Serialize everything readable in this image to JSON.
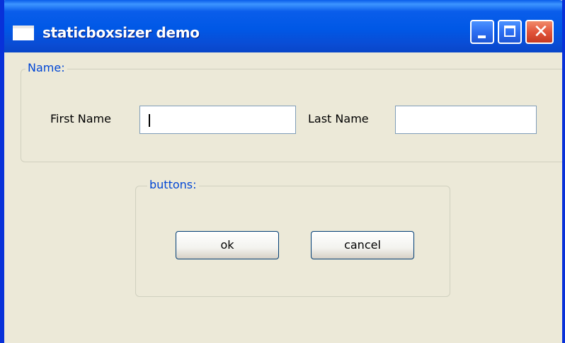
{
  "window": {
    "title": "staticboxsizer demo",
    "controls": {
      "minimize_icon": "minimize-icon",
      "maximize_icon": "maximize-icon",
      "close_icon": "close-icon",
      "close_glyph": "✕"
    },
    "colors": {
      "titlebar": "#0a5dea",
      "body": "#ece9d8",
      "groupbox_label": "#0046d5",
      "close_button": "#e2553b"
    }
  },
  "name_group": {
    "label": "Name:",
    "first_name_label": "First Name",
    "first_name_value": "",
    "last_name_label": "Last Name",
    "last_name_value": ""
  },
  "buttons_group": {
    "label": "buttons:",
    "ok_label": "ok",
    "cancel_label": "cancel"
  }
}
